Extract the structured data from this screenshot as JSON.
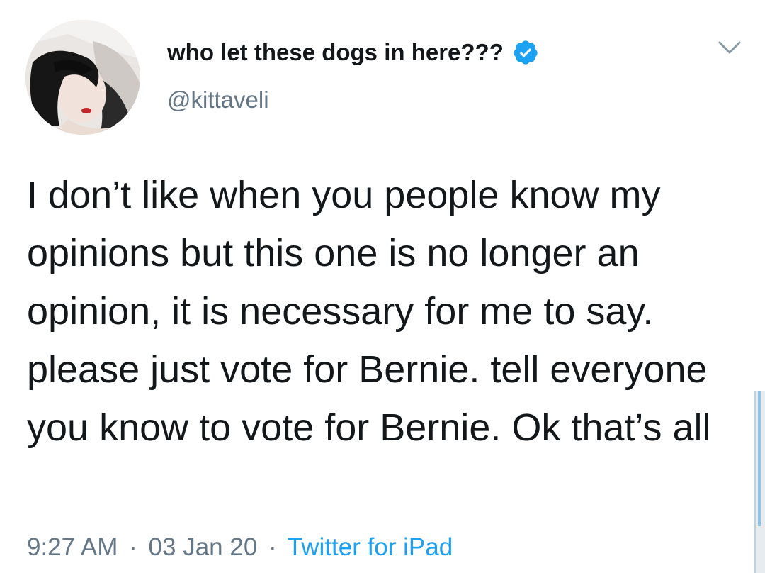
{
  "tweet": {
    "display_name": "who let these dogs in here???",
    "handle": "@kittaveli",
    "verified": true,
    "text": "I don’t like when you people know my opinions but this one is no longer an opinion, it is necessary for me to say. please just vote for Bernie. tell everyone you know to vote for Bernie. Ok that’s all",
    "time": "9:27 AM",
    "separator": "·",
    "date": "03 Jan 20",
    "source": "Twitter for iPad"
  },
  "icons": {
    "verified": "verified-badge-icon",
    "menu": "chevron-down-icon"
  },
  "colors": {
    "verified_blue": "#1da1f2",
    "secondary_text": "#657786",
    "primary_text": "#14171a",
    "link": "#1da1f2"
  }
}
